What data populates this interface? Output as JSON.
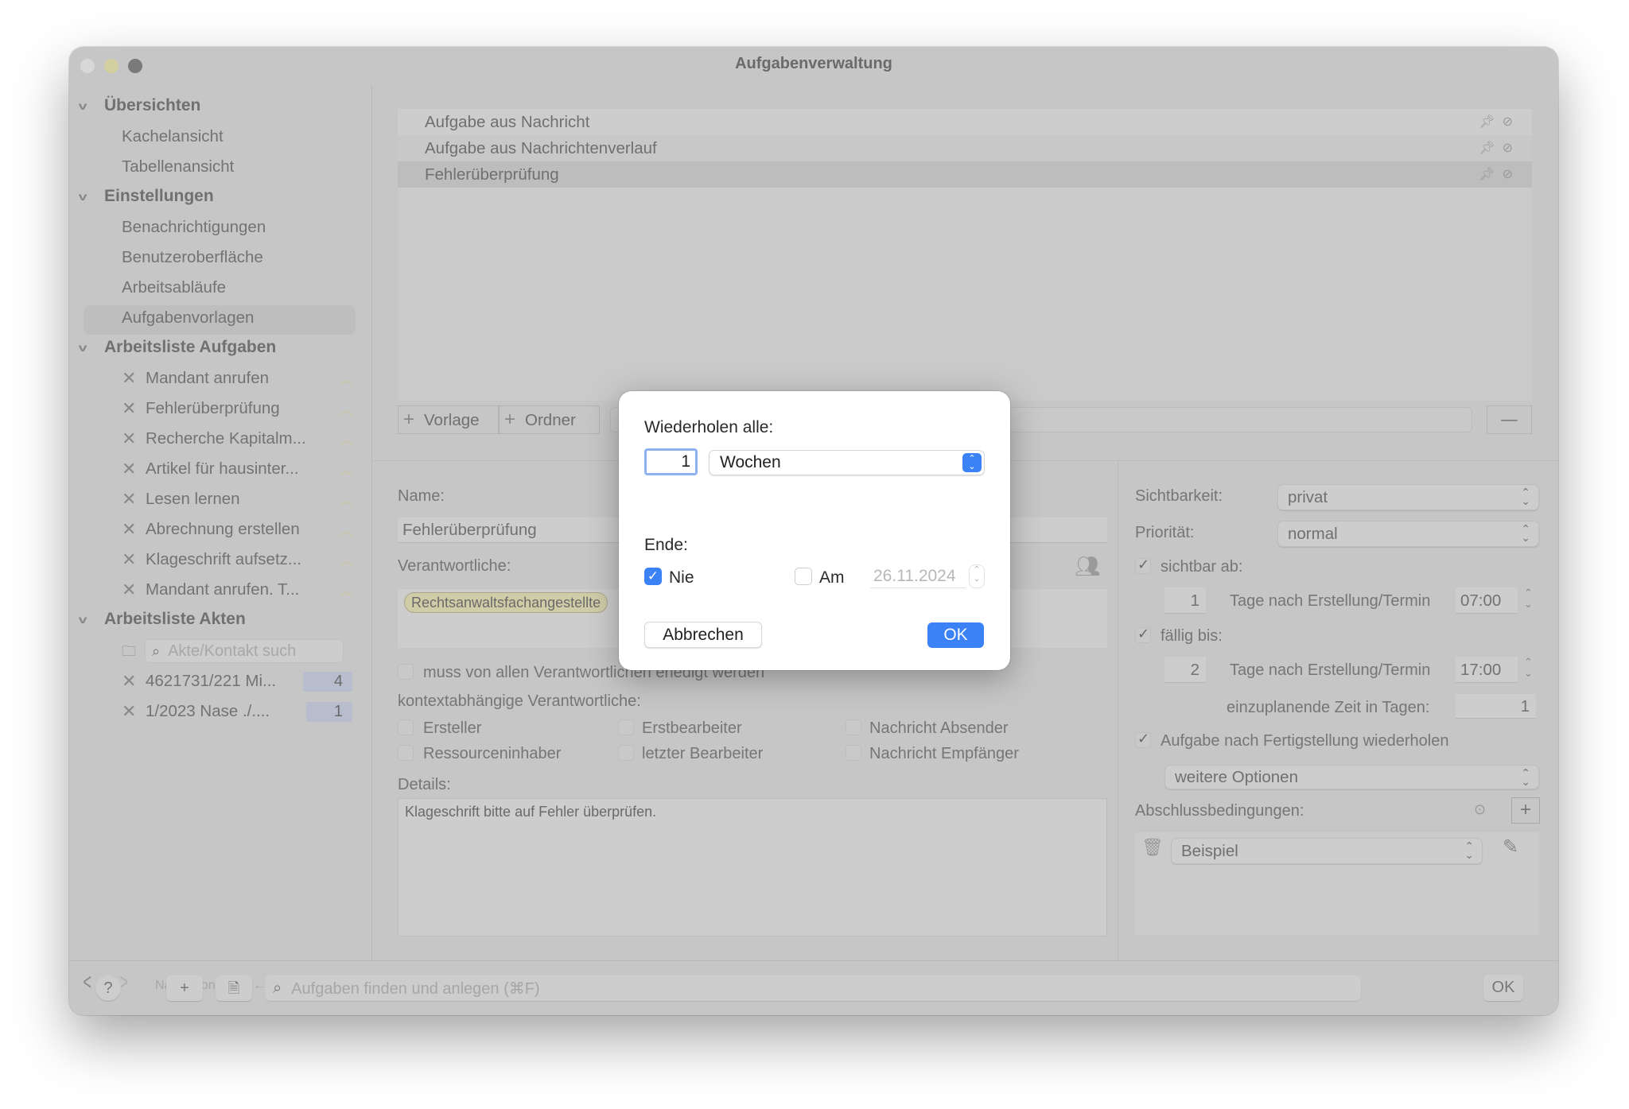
{
  "window": {
    "title": "Aufgabenverwaltung",
    "traffic_light_colors": [
      "#d8d8d8",
      "#d4cf9e",
      "#7a7a7a"
    ]
  },
  "sidebar": {
    "sections": [
      {
        "label": "Übersichten",
        "items": [
          "Kachelansicht",
          "Tabellenansicht"
        ]
      },
      {
        "label": "Einstellungen",
        "items": [
          "Benachrichtigungen",
          "Benutzeroberfläche",
          "Arbeitsabläufe",
          "Aufgabenvorlagen"
        ],
        "selected": "Aufgabenvorlagen"
      },
      {
        "label": "Arbeitsliste Aufgaben",
        "items": [
          "Mandant anrufen",
          "Fehlerüberprüfung",
          "Recherche Kapitalm...",
          "Artikel für hausinter...",
          "Lesen lernen",
          "Abrechnung erstellen",
          "Klageschrift aufsetz...",
          "Mandant anrufen. T..."
        ]
      },
      {
        "label": "Arbeitsliste Akten",
        "search_placeholder": "Akte/Kontakt such",
        "items": [
          {
            "label": "4621731/221 Mi...",
            "count": "4"
          },
          {
            "label": "1/2023 Nase ./....",
            "count": "1"
          }
        ]
      }
    ],
    "nav_hint": "Navigation per ⌘← bzw. ⌘→"
  },
  "templates": {
    "rows": [
      "Aufgabe aus Nachricht",
      "Aufgabe aus Nachrichtenverlauf",
      "Fehlerüberprüfung"
    ],
    "selected_index": 2,
    "add_template_label": "Vorlage",
    "add_folder_label": "Ordner",
    "remove_label": "—"
  },
  "form": {
    "name_label": "Name:",
    "name_value": "Fehlerüberprüfung",
    "responsible_label": "Verantwortliche:",
    "responsible_tokens": [
      "Rechtsanwaltsfachangestellte"
    ],
    "all_must_complete_label": "muss von allen Verantwortlichen erledigt werden",
    "context_label": "kontextabhängige Verantwortliche:",
    "context_options": [
      {
        "label": "Ersteller",
        "checked": false
      },
      {
        "label": "Erstbearbeiter",
        "checked": false
      },
      {
        "label": "Nachricht Absender",
        "checked": false
      },
      {
        "label": "Ressourceninhaber",
        "checked": false
      },
      {
        "label": "letzter Bearbeiter",
        "checked": false
      },
      {
        "label": "Nachricht Empfänger",
        "checked": false
      }
    ],
    "details_label": "Details:",
    "details_value": "Klageschrift bitte auf Fehler überprüfen."
  },
  "options": {
    "visibility_label": "Sichtbarkeit:",
    "visibility_value": "privat",
    "priority_label": "Priorität:",
    "priority_value": "normal",
    "visible_from_label": "sichtbar ab:",
    "visible_from_checked": true,
    "visible_from_days": "1",
    "days_after_label": "Tage nach Erstellung/Termin",
    "visible_from_time": "07:00",
    "due_label": "fällig bis:",
    "due_checked": true,
    "due_days": "2",
    "due_time": "17:00",
    "planned_time_label": "einzuplanende Zeit in Tagen:",
    "planned_time_value": "1",
    "repeat_label": "Aufgabe nach Fertigstellung wiederholen",
    "repeat_checked": true,
    "more_options_label": "weitere Optionen",
    "completion_label": "Abschlussbedingungen:",
    "completion_add": "+",
    "completion_value": "Beispiel"
  },
  "bottombar": {
    "help": "?",
    "add": "+",
    "search_placeholder": "Aufgaben finden und anlegen (⌘F)",
    "ok": "OK"
  },
  "dialog": {
    "repeat_every_label": "Wiederholen alle:",
    "interval_value": "1",
    "unit_value": "Wochen",
    "end_label": "Ende:",
    "never_label": "Nie",
    "never_checked": true,
    "on_label": "Am",
    "on_checked": false,
    "end_date": "26.11.2024",
    "cancel_label": "Abbrechen",
    "ok_label": "OK",
    "accent_color": "#3b82f6"
  }
}
